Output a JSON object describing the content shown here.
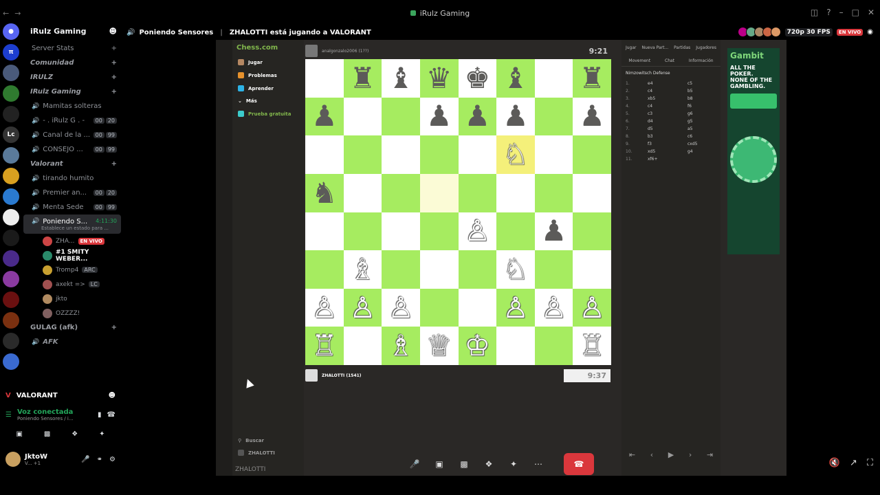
{
  "window": {
    "title": "iRulz Gaming"
  },
  "topbar": {
    "channel": "Poniendo Sensores",
    "activity": "ZHALOTTI está jugando a VALORANT",
    "quality": "720p 30 FPS",
    "live": "EN VIVO"
  },
  "server": {
    "name": "iRulz Gaming"
  },
  "sidebar": {
    "server_stats": "Server Stats",
    "cat_comunidad": "Comunidad",
    "cat_irulz": "IRULZ",
    "cat_irulz_gaming": "IRulz Gaming",
    "cat_valorant": "Valorant",
    "cat_gulag": "GULAG (afk)",
    "channels": [
      {
        "label": "Mamitas solteras",
        "b1": "",
        "b2": ""
      },
      {
        "label": "- . iRulz G . -",
        "b1": "00",
        "b2": "20"
      },
      {
        "label": "Canal de la ...",
        "b1": "00",
        "b2": "99"
      },
      {
        "label": "CONSEJO ...",
        "b1": "00",
        "b2": "99"
      }
    ],
    "valorant_channels": [
      {
        "label": "tirando humito",
        "b1": "",
        "b2": ""
      },
      {
        "label": "Premier an...",
        "b1": "00",
        "b2": "20"
      },
      {
        "label": "Menta Sede",
        "b1": "00",
        "b2": "99"
      }
    ],
    "active": {
      "label": "Poniendo S...",
      "time": "4:11:30",
      "sub": "Establece un estado para ..."
    },
    "members": [
      {
        "name": "ZHA...",
        "live": "EN VIVO"
      },
      {
        "name": "#1 SMITY WEBER..."
      },
      {
        "name": "Tromp4",
        "tag": "ARC"
      },
      {
        "name": "axekt =>",
        "tag": "LC"
      },
      {
        "name": "jkto"
      },
      {
        "name": "OZZZZ!"
      }
    ],
    "afk": "AFK"
  },
  "voice": {
    "game": "VALORANT",
    "status": "Voz conectada",
    "channel": "Poniendo Sensores / i...",
    "user": "JktoW",
    "user_sub": "V... +1"
  },
  "chess": {
    "logo": "Chess.com",
    "menu": [
      "Jugar",
      "Problemas",
      "Aprender",
      "Más",
      "Prueba gratuita"
    ],
    "search": "Buscar",
    "account": "ZHALOTTI",
    "top_player": "analgonzalo2006 (1??)",
    "top_clock": "9:21",
    "bottom_player": "ZHALOTTI (1541)",
    "bottom_clock": "9:37",
    "board": [
      [
        "",
        "br",
        "bb",
        "bq",
        "bk",
        "bb",
        "",
        "br"
      ],
      [
        "bp",
        "",
        "",
        "bp",
        "bp",
        "bp",
        "",
        "bp"
      ],
      [
        "",
        "",
        "",
        "",
        "",
        "wn",
        "",
        ""
      ],
      [
        "bn",
        "",
        "",
        "",
        "",
        "",
        "",
        ""
      ],
      [
        "",
        "",
        "",
        "",
        "wp",
        "",
        "bp",
        ""
      ],
      [
        "",
        "wb",
        "",
        "",
        "",
        "wn",
        "",
        ""
      ],
      [
        "wp",
        "wp",
        "wp",
        "",
        "",
        "wp",
        "wp",
        "wp"
      ],
      [
        "wr",
        "",
        "wb",
        "wq",
        "wk",
        "",
        "",
        "wr"
      ]
    ],
    "highlight": [
      [
        2,
        5
      ],
      [
        3,
        3
      ]
    ],
    "panel_icons": [
      "Jugar",
      "Nueva Part...",
      "Partidas",
      "Jugadores"
    ],
    "tabs": [
      "Movement",
      "Chat",
      "Información"
    ],
    "opening": "Nimzowitsch Defense",
    "moves": [
      [
        "1.",
        "e4",
        "c5"
      ],
      [
        "2.",
        "c4",
        "b5"
      ],
      [
        "3.",
        "xb5",
        "b8"
      ],
      [
        "4.",
        "c4",
        "f6"
      ],
      [
        "5.",
        "c3",
        "g6"
      ],
      [
        "6.",
        "d4",
        "g5"
      ],
      [
        "7.",
        "d5",
        "a5"
      ],
      [
        "8.",
        "b3",
        "c6"
      ],
      [
        "9.",
        "f3",
        "cxd5"
      ],
      [
        "10.",
        "xd5",
        "g4"
      ],
      [
        "11.",
        "xf6+",
        ""
      ]
    ]
  },
  "ad": {
    "brand": "Gambit",
    "line1": "ALL THE POKER.",
    "line2": "NONE OF THE GAMBLING."
  },
  "stream_title": "ZHALOTTI"
}
